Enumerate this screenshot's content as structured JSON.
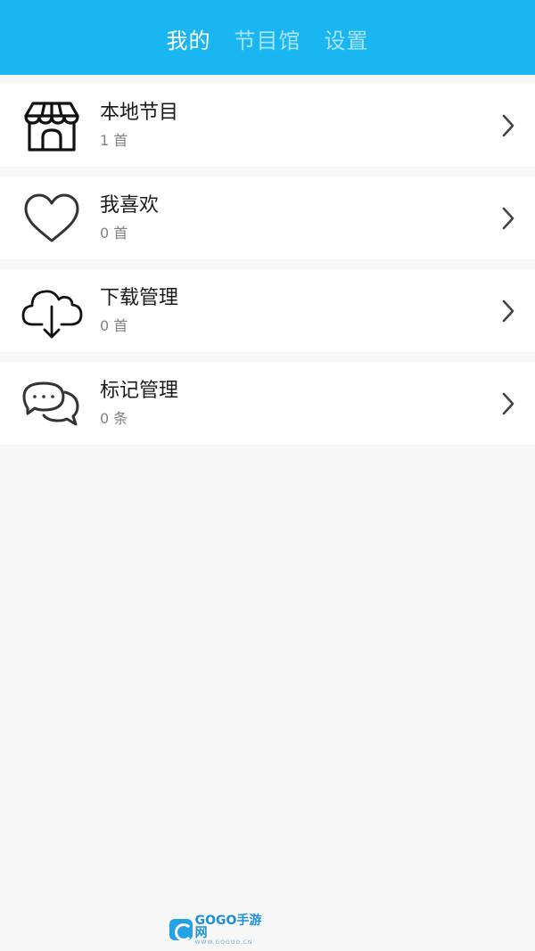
{
  "header": {
    "tabs": [
      {
        "label": "我的",
        "active": true
      },
      {
        "label": "节目馆",
        "active": false
      },
      {
        "label": "设置",
        "active": false
      }
    ],
    "background_color": "#1ab6f2"
  },
  "list": {
    "items": [
      {
        "title": "本地节目",
        "count": "1 首",
        "icon": "store-icon"
      },
      {
        "title": "我喜欢",
        "count": "0 首",
        "icon": "heart-icon"
      },
      {
        "title": "下载管理",
        "count": "0 首",
        "icon": "cloud-download-icon"
      },
      {
        "title": "标记管理",
        "count": "0 条",
        "icon": "chat-bubbles-icon"
      }
    ]
  },
  "watermark": {
    "main": "GOGO手游网",
    "sub": "WWW.GOGOO.CN"
  }
}
